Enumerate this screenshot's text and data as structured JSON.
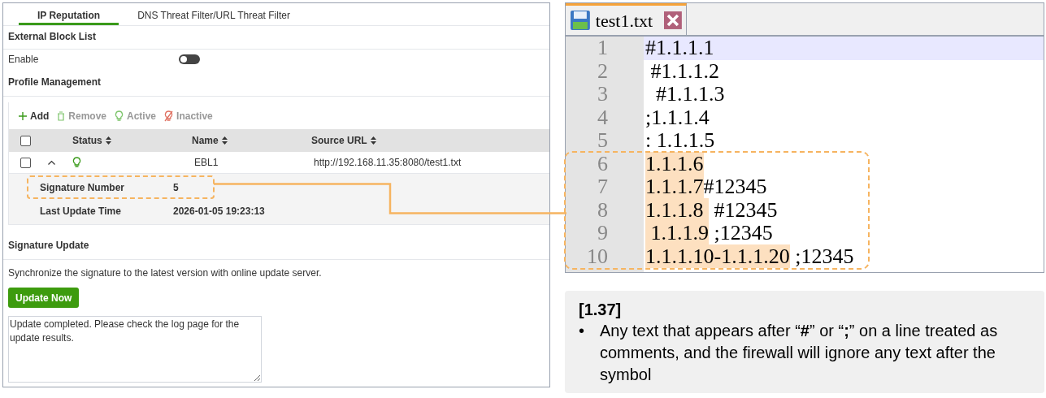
{
  "settings_panel": {
    "tabs": [
      {
        "label": "IP Reputation",
        "selected": true
      },
      {
        "label": "DNS Threat Filter/URL Threat Filter",
        "selected": false
      }
    ],
    "external_block_list": {
      "title": "External Block List",
      "enable_label": "Enable",
      "enable_on": false
    },
    "profile_management": {
      "title": "Profile Management",
      "toolbar": [
        {
          "kind": "add",
          "label": "Add",
          "disabled": false
        },
        {
          "kind": "remove",
          "label": "Remove",
          "disabled": true
        },
        {
          "kind": "active",
          "label": "Active",
          "disabled": true
        },
        {
          "kind": "inactive",
          "label": "Inactive",
          "disabled": true
        }
      ],
      "table": {
        "select_all_checked": false,
        "columns": [
          "Status",
          "Name",
          "Source URL"
        ],
        "rows": [
          {
            "checked": false,
            "expanded": true,
            "active": true,
            "name": "EBL1",
            "source_url": "http://192.168.11.35:8080/test1.txt",
            "details": [
              {
                "label": "Signature Number",
                "value": "5",
                "callout": true
              },
              {
                "label": "Last Update Time",
                "value": "2026-01-05 19:23:13",
                "callout": false
              }
            ]
          }
        ]
      }
    },
    "signature_update": {
      "title": "Signature Update",
      "description": "Synchronize the signature to the latest version with online update server.",
      "button": "Update Now",
      "result": "Update completed. Please check the log page for the update results."
    }
  },
  "editor": {
    "tab": {
      "title": "test1.txt"
    },
    "lines": [
      {
        "number": "1",
        "current": true,
        "callout": false,
        "parts": [
          {
            "text": "#1.1.1.1",
            "highlighted": false
          }
        ]
      },
      {
        "number": "2",
        "current": false,
        "callout": false,
        "parts": [
          {
            "text": " #1.1.1.2",
            "highlighted": false
          }
        ]
      },
      {
        "number": "3",
        "current": false,
        "callout": false,
        "parts": [
          {
            "text": "  #1.1.1.3",
            "highlighted": false
          }
        ]
      },
      {
        "number": "4",
        "current": false,
        "callout": false,
        "parts": [
          {
            "text": ";1.1.1.4",
            "highlighted": false
          }
        ]
      },
      {
        "number": "5",
        "current": false,
        "callout": false,
        "parts": [
          {
            "text": ": 1.1.1.5",
            "highlighted": false
          }
        ]
      },
      {
        "number": "6",
        "current": false,
        "callout": true,
        "parts": [
          {
            "text": "1.1.1.6",
            "highlighted": true
          }
        ]
      },
      {
        "number": "7",
        "current": false,
        "callout": true,
        "parts": [
          {
            "text": "1.1.1.7",
            "highlighted": true
          },
          {
            "text": "#12345",
            "highlighted": false
          }
        ]
      },
      {
        "number": "8",
        "current": false,
        "callout": true,
        "parts": [
          {
            "text": "1.1.1.8 ",
            "highlighted": true
          },
          {
            "text": " #12345",
            "highlighted": false
          }
        ]
      },
      {
        "number": "9",
        "current": false,
        "callout": true,
        "parts": [
          {
            "text": " 1.1.1.9",
            "highlighted": true
          },
          {
            "text": " ;12345",
            "highlighted": false
          }
        ]
      },
      {
        "number": "10",
        "current": false,
        "callout": true,
        "parts": [
          {
            "text": "1.1.1.10-1.1.1.20",
            "highlighted": true
          },
          {
            "text": " ;12345",
            "highlighted": false
          }
        ]
      }
    ]
  },
  "note": {
    "title": "[1.37]",
    "bullets": [
      {
        "marker": "•",
        "text": "Any text that appears after “**#**” or “**;**” on a line treated as comments, and the firewall will ignore any text after the symbol"
      }
    ]
  }
}
